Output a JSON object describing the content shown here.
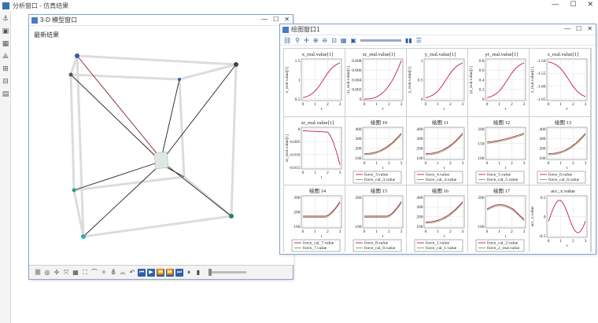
{
  "app": {
    "title": "分析窗口 - 仿真结果",
    "win_controls": [
      "—",
      "☐",
      "✕"
    ]
  },
  "left_toolbar": [
    "⚓",
    "▣",
    "▦",
    "⟁",
    "⊞",
    "⊟",
    "▤"
  ],
  "view3d": {
    "title": "3-D 模型窗口",
    "subtitle": "最新结果",
    "toolbar": [
      "⫼⫼",
      "◎",
      "✢",
      "⤧",
      "▦",
      "⛶",
      "⌒",
      "✧",
      "⛢",
      "⌓",
      "↶"
    ],
    "play_buttons": [
      "⏮",
      "▶",
      "⏪",
      "⏩",
      "⏭"
    ],
    "extra": [
      "⏸",
      "▮"
    ]
  },
  "plotwin": {
    "title": "绘图窗口1",
    "toolbar": [
      "⛓",
      "⚲",
      "✛",
      "⊕",
      "⊖",
      "⊡",
      "▦",
      "▣",
      "▮▮",
      "☰"
    ]
  },
  "plots": [
    {
      "title": "x_real.value[1]",
      "ylabel": "x_real.value[1]",
      "yticks": [
        "1.5",
        "1",
        "0.5"
      ],
      "xticks": [
        "0",
        "1",
        "2",
        "3"
      ],
      "xlabel": "t",
      "curve": "s_up",
      "legend": []
    },
    {
      "title": "xr_real.value[1]",
      "ylabel": "xr_real.value[1]",
      "yticks": [
        "0.008",
        "0.006",
        "0.004",
        "0.002",
        "0"
      ],
      "xticks": [
        "0",
        "1",
        "2",
        "3"
      ],
      "xlabel": "t",
      "curve": "exp_up",
      "legend": []
    },
    {
      "title": "y_real.value[1]",
      "ylabel": "y_real.value[1]",
      "yticks": [
        "1",
        "0.5",
        "0"
      ],
      "xticks": [
        "0",
        "1",
        "2",
        "3"
      ],
      "xlabel": "t",
      "curve": "s_up",
      "legend": []
    },
    {
      "title": "yr_real.value[1]",
      "ylabel": "yr_real.value[1]",
      "yticks": [
        "0.8",
        "0.6",
        "0.4",
        "0.2",
        "0"
      ],
      "xticks": [
        "0",
        "1",
        "2",
        "3"
      ],
      "xlabel": "t",
      "curve": "s_up",
      "legend": []
    },
    {
      "title": "z_real.value[1]",
      "ylabel": "z_real.value[1]",
      "yticks": [
        "-1.50",
        "-1.55",
        "-1.60",
        "-1.65"
      ],
      "xticks": [
        "0",
        "1",
        "2",
        "3"
      ],
      "xlabel": "t",
      "curve": "s_down",
      "legend": []
    },
    {
      "title": "zr_real.value[1]",
      "ylabel": "zr_real.value[1]",
      "yticks": [
        "0",
        "-0.005",
        "-0.010",
        "-0.015"
      ],
      "xticks": [
        "0",
        "1",
        "2",
        "3"
      ],
      "xlabel": "t",
      "curve": "drop_end",
      "legend": []
    },
    {
      "title": "绘图 10",
      "ylabel": "",
      "yticks": [
        "400",
        "300",
        "200",
        "100"
      ],
      "xticks": [
        "0",
        "1",
        "2",
        "3"
      ],
      "xlabel": "t",
      "curve": "rise_two",
      "legend": [
        "force_3.value",
        "force_cal_3.value"
      ]
    },
    {
      "title": "绘图 11",
      "ylabel": "",
      "yticks": [
        "400",
        "300",
        "200",
        "100"
      ],
      "xticks": [
        "0",
        "1",
        "2",
        "3"
      ],
      "xlabel": "t",
      "curve": "rise_two",
      "legend": [
        "force_4.value",
        "force_cal_4.value"
      ]
    },
    {
      "title": "绘图 12",
      "ylabel": "",
      "yticks": [
        "200",
        "150",
        "100"
      ],
      "xticks": [
        "0",
        "1",
        "2",
        "3"
      ],
      "xlabel": "t",
      "curve": "flat_two",
      "legend": [
        "force_5.value",
        "force_cal_5.value"
      ]
    },
    {
      "title": "绘图 13",
      "ylabel": "",
      "yticks": [
        "400",
        "300",
        "200",
        "100"
      ],
      "xticks": [
        "0",
        "1",
        "2",
        "3"
      ],
      "xlabel": "t",
      "curve": "rise_two",
      "legend": [
        "force_6.value",
        "force_cal_6.value"
      ]
    },
    {
      "title": "绘图 14",
      "ylabel": "",
      "yticks": [
        "300",
        "200",
        "100"
      ],
      "xticks": [
        "0",
        "1",
        "2",
        "3"
      ],
      "xlabel": "t",
      "curve": "flat_rise",
      "legend": [
        "force_cal_7.value",
        "force_7.value"
      ]
    },
    {
      "title": "绘图 15",
      "ylabel": "",
      "yticks": [
        "200",
        "100"
      ],
      "xticks": [
        "0",
        "1",
        "2",
        "3"
      ],
      "xlabel": "t",
      "curve": "flat_rise",
      "legend": [
        "force_8.value",
        "force_cal_8.value"
      ]
    },
    {
      "title": "绘图 16",
      "ylabel": "",
      "yticks": [
        "400",
        "300",
        "200",
        "100"
      ],
      "xticks": [
        "0",
        "1",
        "2",
        "3"
      ],
      "xlabel": "t",
      "curve": "rise_two",
      "legend": [
        "force_1.value",
        "force_cal_1.value"
      ]
    },
    {
      "title": "绘图 17",
      "ylabel": "",
      "yticks": [
        "200",
        "100"
      ],
      "xticks": [
        "0",
        "1",
        "2",
        "3"
      ],
      "xlabel": "t",
      "curve": "hump",
      "legend": [
        "force_cal_2.value",
        "force_2_real.value"
      ]
    },
    {
      "title": "acc_x.value",
      "ylabel": "acc_x.value",
      "yticks": [
        "0.5",
        "0",
        "-0.5"
      ],
      "xticks": [
        "0",
        "1",
        "2",
        "3"
      ],
      "xlabel": "t",
      "curve": "sine",
      "legend": []
    }
  ],
  "colors": {
    "series1": "#c2185b",
    "series2": "#6fa84a",
    "grid": "#d9d9d9",
    "accent": "#2e5ea8"
  }
}
